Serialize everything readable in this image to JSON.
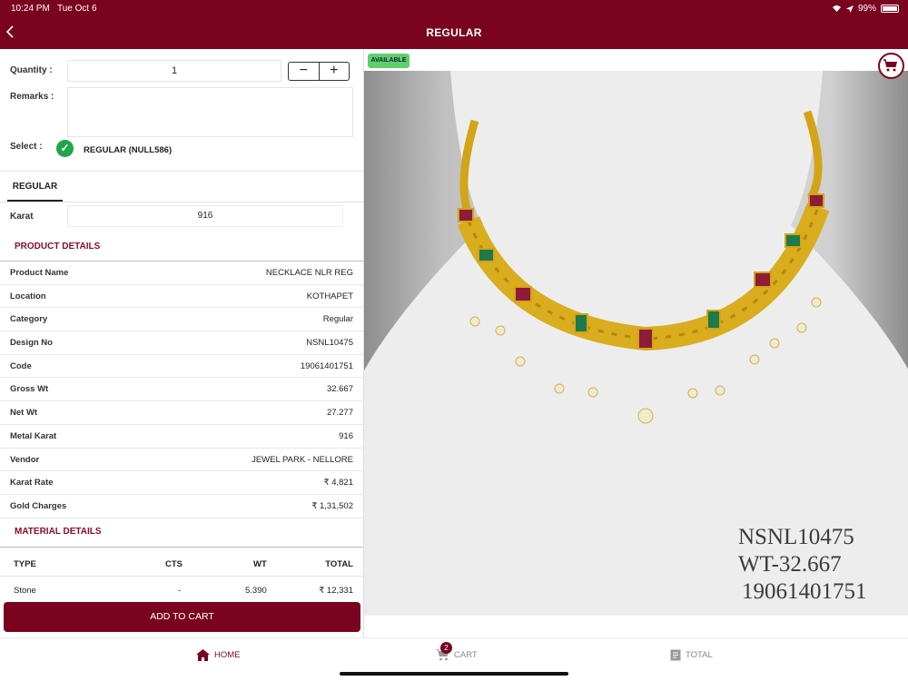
{
  "status": {
    "time": "10:24 PM",
    "date": "Tue Oct 6",
    "battery": "99%"
  },
  "header": {
    "title": "REGULAR"
  },
  "form": {
    "quantity_label": "Quantity :",
    "quantity_value": "1",
    "remarks_label": "Remarks :",
    "remarks_value": "",
    "select_label": "Select :",
    "select_value": "REGULAR (NULL586)"
  },
  "tabs": [
    {
      "label": "REGULAR"
    }
  ],
  "karat": {
    "label": "Karat",
    "value": "916"
  },
  "product_details_title": "PRODUCT DETAILS",
  "product_details": [
    {
      "key": "Product Name",
      "value": "NECKLACE NLR REG"
    },
    {
      "key": "Location",
      "value": "KOTHAPET"
    },
    {
      "key": "Category",
      "value": "Regular"
    },
    {
      "key": "Design No",
      "value": "NSNL10475"
    },
    {
      "key": "Code",
      "value": "19061401751"
    },
    {
      "key": "Gross Wt",
      "value": "32.667"
    },
    {
      "key": "Net Wt",
      "value": "27.277"
    },
    {
      "key": "Metal Karat",
      "value": "916"
    },
    {
      "key": "Vendor",
      "value": "JEWEL PARK - NELLORE"
    },
    {
      "key": "Karat Rate",
      "value": "₹ 4,821"
    },
    {
      "key": "Gold Charges",
      "value": "₹ 1,31,502"
    }
  ],
  "material_details_title": "MATERIAL DETAILS",
  "material": {
    "headers": {
      "type": "TYPE",
      "cts": "CTS",
      "wt": "WT",
      "total": "TOTAL"
    },
    "rows": [
      {
        "type": "Stone",
        "cts": "-",
        "wt": "5.390",
        "total": "₹ 12,331"
      }
    ]
  },
  "add_to_cart_label": "ADD TO CART",
  "image": {
    "badge": "AVAILABLE",
    "lines": [
      "NSNL10475",
      "WT-32.667",
      "19061401751"
    ]
  },
  "bottom_nav": {
    "home": "HOME",
    "cart": "CART",
    "cart_count": "2",
    "total": "TOTAL"
  },
  "colors": {
    "brand": "#7a0420",
    "available": "#5fcf6e",
    "check": "#1fa64a"
  }
}
